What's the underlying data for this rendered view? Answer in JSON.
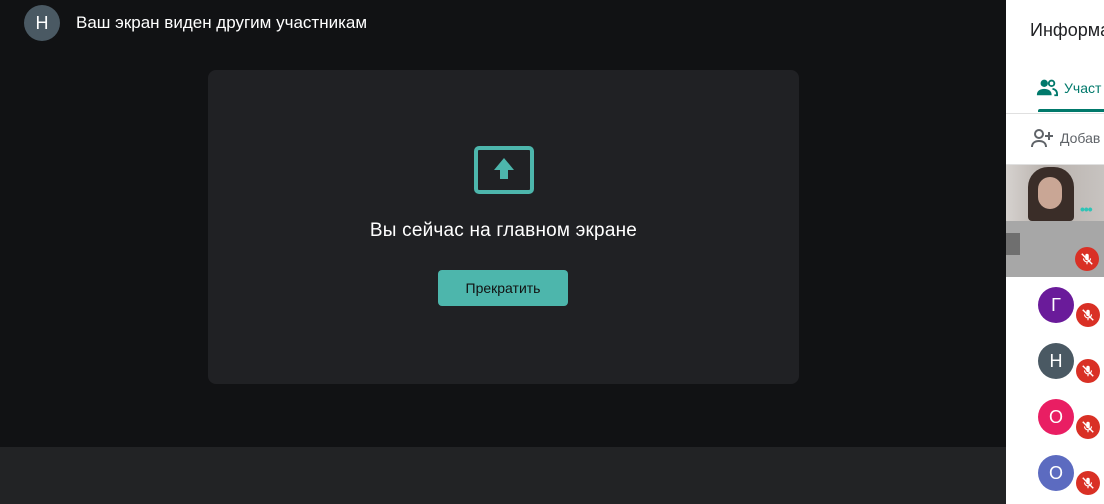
{
  "top": {
    "avatar_letter": "Н",
    "title": "Ваш экран виден другим участникам"
  },
  "card": {
    "icon": "present-to-all-icon",
    "title": "Вы сейчас на главном экране",
    "stop_label": "Прекратить"
  },
  "sidebar": {
    "title": "Информа",
    "tab_label": "Участ",
    "add_label": "Добав",
    "participants": [
      {
        "letter": "Г",
        "color": "#6a1b9a"
      },
      {
        "letter": "Н",
        "color": "#4a5963"
      },
      {
        "letter": "О",
        "color": "#e91e63"
      },
      {
        "letter": "О",
        "color": "#5c6bc0"
      }
    ]
  },
  "colors": {
    "accent": "#4db6ac",
    "tab_accent": "#00796b",
    "mute_red": "#d93025"
  }
}
